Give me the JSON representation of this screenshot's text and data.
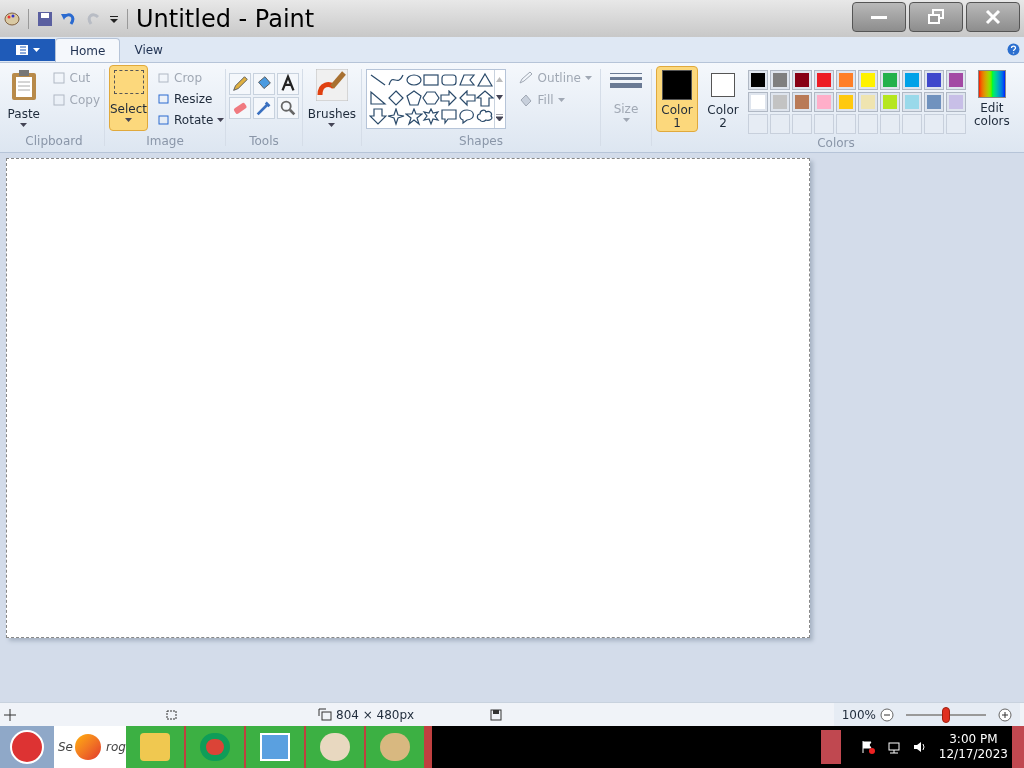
{
  "window": {
    "title": "Untitled - Paint"
  },
  "tabs": [
    {
      "label": "Home",
      "selected": true
    },
    {
      "label": "View",
      "selected": false
    }
  ],
  "clipboard": {
    "label": "Clipboard",
    "paste": "Paste",
    "items": [
      {
        "label": "Cut",
        "disabled": true
      },
      {
        "label": "Copy",
        "disabled": true
      }
    ]
  },
  "image": {
    "label": "Image",
    "select": {
      "label": "Select",
      "selected": true
    },
    "items": [
      {
        "label": "Crop",
        "disabled": true
      },
      {
        "label": "Resize",
        "disabled": false
      },
      {
        "label": "Rotate",
        "disabled": false
      }
    ]
  },
  "tools": {
    "label": "Tools"
  },
  "brushes": {
    "label": "Brushes"
  },
  "shapes": {
    "label": "Shapes",
    "outline": {
      "label": "Outline",
      "disabled": true
    },
    "fill": {
      "label": "Fill",
      "disabled": true
    }
  },
  "size": {
    "label": "Size",
    "disabled": true
  },
  "colors": {
    "label": "Colors",
    "slots": [
      {
        "line1": "Color",
        "line2": "1",
        "color": "#000000",
        "selected": true
      },
      {
        "line1": "Color",
        "line2": "2",
        "color": "#ffffff",
        "selected": false
      }
    ],
    "palette": [
      {
        "color": "#000000"
      },
      {
        "color": "#7f7f7f"
      },
      {
        "color": "#880015"
      },
      {
        "color": "#ed1c24"
      },
      {
        "color": "#ff7f27"
      },
      {
        "color": "#fff200"
      },
      {
        "color": "#22b14c"
      },
      {
        "color": "#00a2e8"
      },
      {
        "color": "#3f48cc"
      },
      {
        "color": "#a349a4"
      },
      {
        "color": "#ffffff"
      },
      {
        "color": "#c3c3c3"
      },
      {
        "color": "#b97a57"
      },
      {
        "color": "#ffaec9"
      },
      {
        "color": "#ffc90e"
      },
      {
        "color": "#efe4b0"
      },
      {
        "color": "#b5e61d"
      },
      {
        "color": "#99d9ea"
      },
      {
        "color": "#7092be"
      },
      {
        "color": "#c8bfe7"
      }
    ],
    "edit_line1": "Edit",
    "edit_line2": "colors"
  },
  "status_bar": {
    "canvas_size": "804 × 480px",
    "zoom": "100%",
    "zoom_slider": {
      "level": 0.5
    }
  },
  "taskbar": {
    "search_left": "Se",
    "search_right": "rog",
    "time": "3:00 PM",
    "date": "12/17/2023"
  }
}
